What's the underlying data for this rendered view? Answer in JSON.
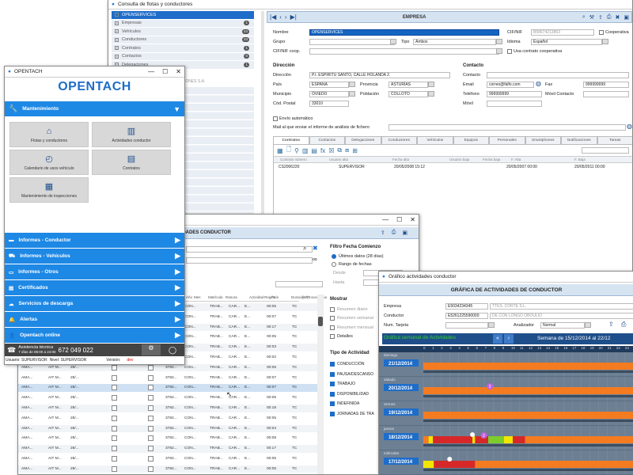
{
  "empresa_window": {
    "title": "Consulta de flotas y conductores",
    "header_title": "EMPRESA",
    "tree": [
      {
        "label": "OPENSERVICES",
        "badge": "",
        "selected": true
      },
      {
        "label": "Empresas",
        "badge": "1"
      },
      {
        "label": "Vehículos",
        "badge": "44"
      },
      {
        "label": "Conductores",
        "badge": "23"
      },
      {
        "label": "Contratos",
        "badge": "1"
      },
      {
        "label": "Contactos",
        "badge": "0"
      },
      {
        "label": "Delegaciones",
        "badge": "1"
      }
    ],
    "tree_fragment": "ACIONES S.A.",
    "form": {
      "nombre_label": "Nombre",
      "nombre_value": "OPENSERVICES",
      "cifnif_label": "CIF/NIF",
      "cifnif_value": "B58674213863",
      "cooperativa_label": "Cooperativa",
      "grupo_label": "Grupo",
      "tipo_label": "Tipo",
      "tipo_value": "Ambos",
      "idioma_label": "Idioma",
      "idioma_value": "Español",
      "cifcoop_label": "CIF/NIF coop.",
      "contrato_coop_label": "Usa contrato cooperativa",
      "direccion_section": "Dirección",
      "contacto_section": "Contacto",
      "direccion_label": "Dirección",
      "direccion_value": "P.I. ESPÍRITU SANTO, CALLE HOLANDA 2.",
      "pais_label": "País",
      "pais_value": "ESPAÑA",
      "provincia_label": "Provincia",
      "provincia_value": "ASTURIAS",
      "municipio_label": "Municipio",
      "municipio_value": "OVIEDO",
      "poblacion_label": "Población",
      "poblacion_value": "COLLOTO",
      "cp_label": "Cód. Postal",
      "cp_value": "33010",
      "contacto_label": "Contacto",
      "email_label": "Email",
      "email_value": "correo@falfo.com",
      "fax_label": "Fax",
      "fax_value": "999999999",
      "telefono_label": "Teléfono",
      "telefono_value": "999999999",
      "movil_contacto_label": "Móvil Contacto",
      "movil_label": "Móvil",
      "envio_label": "Envío automático",
      "informe_label": "Mail al que enviar el informe de análisis de fichero"
    },
    "tabs": [
      "Contratos",
      "Contactos",
      "Delegaciones",
      "Conductores",
      "Vehículos",
      "Equipos",
      "Personales",
      "Smartphones",
      "Notificaciones",
      "Tareas"
    ],
    "grid_headers": [
      "Contrato número",
      "Usuario alta",
      "Fecha alta",
      "Usuario baja",
      "Fecha baja",
      "F. Alta",
      "F. Baja"
    ],
    "grid_row": [
      "CS2006220",
      "SUPERVISOR",
      "20/05/2008 15:12",
      "",
      "",
      "20/05/2007 00:00",
      "20/05/2011 00:00"
    ]
  },
  "opentach_window": {
    "title": "OPENTACH",
    "logo": "OPENTACH",
    "mantenimiento": "Mantenimiento",
    "tiles": [
      "Flotas y conductores",
      "Actividades conductor",
      "Calendario de usos vehículo",
      "Contratos",
      "Mantenimiento de inspecciones"
    ],
    "menu": [
      "Informes - Conductor",
      "Informes - Vehículos",
      "Informes - Otros",
      "Certificados",
      "Servicios de descarga",
      "Alertas",
      "Opentach online"
    ],
    "support_title": "Asistencia técnica",
    "support_hours": "7 días de 08:00 a 24:00",
    "support_phone": "672 049 022",
    "status_user": "Usuario: SUPERVISOR",
    "status_level": "Nivel: SUPERVISOR",
    "status_version_label": "Versión:",
    "status_version": "dev"
  },
  "actividades_window": {
    "header_title": "IVIDADES CONDUCTOR",
    "filtro_title": "Filtro Fecha Comienzo",
    "opt_ultimos": "Últimos datos (28 días)",
    "opt_rango": "Rango de fechas",
    "desde_label": "Desde",
    "hasta_label": "Hasta",
    "mostrar_title": "Mostrar",
    "mostrar_opts": [
      "Resumen diario",
      "Resumen semanal",
      "Resumen mensual",
      "Detalles"
    ],
    "tipo_title": "Tipo de Actividad",
    "tipo_opts": [
      "CONDUCCIÓN",
      "PAUSA/DESCANSO",
      "TRABAJO",
      "DISPONIBILIDAD",
      "INDEFINIDA",
      "JORNADAS DE TRA"
    ],
    "col_headers": [
      "Año",
      "Mes",
      "Matrícula",
      "Ranura",
      "Actividad",
      "Región",
      "País",
      "Duración",
      "(Hh)",
      "Procedencia"
    ],
    "rows": [
      [
        "AMA...",
        "AIT M...",
        "28/...",
        "3782...",
        "CON...",
        "TRAB...",
        "CAR...",
        "E...",
        "00:05",
        "TC"
      ],
      [
        "AMA...",
        "AIT M...",
        "28/...",
        "3782...",
        "CON...",
        "TRAB...",
        "CAR...",
        "E...",
        "00:07",
        "TC"
      ],
      [
        "AMA...",
        "AIT M...",
        "28/...",
        "3782...",
        "CON...",
        "TRAB...",
        "CAR...",
        "E...",
        "00:17",
        "TC"
      ],
      [
        "AMA...",
        "AIT M...",
        "28/...",
        "3782...",
        "CON...",
        "TRAB...",
        "CAR...",
        "E...",
        "00:05",
        "TC"
      ],
      [
        "AMA...",
        "AIT M...",
        "28/...",
        "3782...",
        "CON...",
        "TRAB...",
        "CAR...",
        "E...",
        "00:03",
        "TC"
      ],
      [
        "AMA...",
        "AIT M...",
        "28/...",
        "3782...",
        "CON...",
        "TRAB...",
        "CAR...",
        "E...",
        "00:02",
        "TC"
      ],
      [
        "AMA...",
        "AIT M...",
        "28/...",
        "3782...",
        "CON...",
        "TRAB...",
        "CAR...",
        "E...",
        "00:05",
        "TC"
      ],
      [
        "AMA...",
        "AIT M...",
        "28/...",
        "3782...",
        "CON...",
        "TRAB...",
        "CAR...",
        "E...",
        "00:07",
        "TC"
      ],
      [
        "AMA...",
        "AIT M...",
        "28/...",
        "3782...",
        "CON...",
        "TRAB...",
        "CAR...",
        "E...",
        "00:07",
        "TC"
      ],
      [
        "AMA...",
        "AIT M...",
        "28/...",
        "3782...",
        "CON...",
        "TRAB...",
        "CAR...",
        "E...",
        "00:05",
        "TC"
      ],
      [
        "AMA...",
        "AIT M...",
        "28/...",
        "3782...",
        "CON...",
        "TRAB...",
        "CAR...",
        "E...",
        "00:18",
        "TC"
      ],
      [
        "AMA...",
        "AIT M...",
        "28/...",
        "3782...",
        "CON...",
        "TRAB...",
        "CAR...",
        "E...",
        "00:05",
        "TC"
      ],
      [
        "AMA...",
        "AIT M...",
        "28/...",
        "3782...",
        "CON...",
        "TRAB...",
        "CAR...",
        "E...",
        "00:04",
        "TC"
      ],
      [
        "AMA...",
        "AIT M...",
        "28/...",
        "3782...",
        "CON...",
        "TRAB...",
        "CAR...",
        "E...",
        "00:08",
        "TC"
      ],
      [
        "AMA...",
        "AIT M...",
        "28/...",
        "3782...",
        "CON...",
        "TRAB...",
        "CAR...",
        "E...",
        "00:17",
        "TC"
      ],
      [
        "AMA...",
        "AIT M...",
        "28/...",
        "3782...",
        "CON...",
        "TRAB...",
        "CAR...",
        "E...",
        "00:05",
        "TC"
      ],
      [
        "AMA...",
        "AIT M...",
        "28/...",
        "3782...",
        "CON...",
        "TRAB...",
        "CAR...",
        "E...",
        "00:05",
        "TC"
      ]
    ]
  },
  "grafico_window": {
    "title": "Gráfico actividades conductor",
    "header_title": "GRÁFICA DE ACTIVIDADES DE CONDUCTOR",
    "empresa_label": "Empresa",
    "empresa_code": "E5034234345",
    "empresa_name": "TTES. CORTE S.L.",
    "conductor_label": "Conductor",
    "conductor_code": "E5261225590000",
    "conductor_name": "DE CON LONGO OBOULIO",
    "tarjeta_label": "Num. Tarjeta",
    "analizador_label": "Analizador",
    "analizador_value": "Normal",
    "semanal_label": "Gráfica semanal de Actividades",
    "semana_label": "Semana de 15/12/2014 al 22/12",
    "hours": [
      "0",
      "1",
      "2",
      "3",
      "4",
      "5",
      "6",
      "7",
      "8",
      "9",
      "10",
      "11",
      "12",
      "13",
      "14",
      "15",
      "16",
      "17",
      "18",
      "19",
      "20",
      "21",
      "22",
      "23"
    ],
    "days": [
      {
        "name": "domingo",
        "date": "21/12/2014",
        "badge": ""
      },
      {
        "name": "sábado",
        "date": "20/12/2014",
        "badge": "2"
      },
      {
        "name": "viernes",
        "date": "19/12/2014",
        "badge": ""
      },
      {
        "name": "jueves",
        "date": "18/12/2014",
        "badge": "2"
      },
      {
        "name": "miércoles",
        "date": "17/12/2014",
        "badge": ""
      }
    ],
    "colors": {
      "descanso": "#f47b20",
      "conduccion": "#d62828",
      "disponibilidad": "#f2e600",
      "trabajo": "#7ccd2c",
      "fondo": "#5c6e82"
    }
  }
}
